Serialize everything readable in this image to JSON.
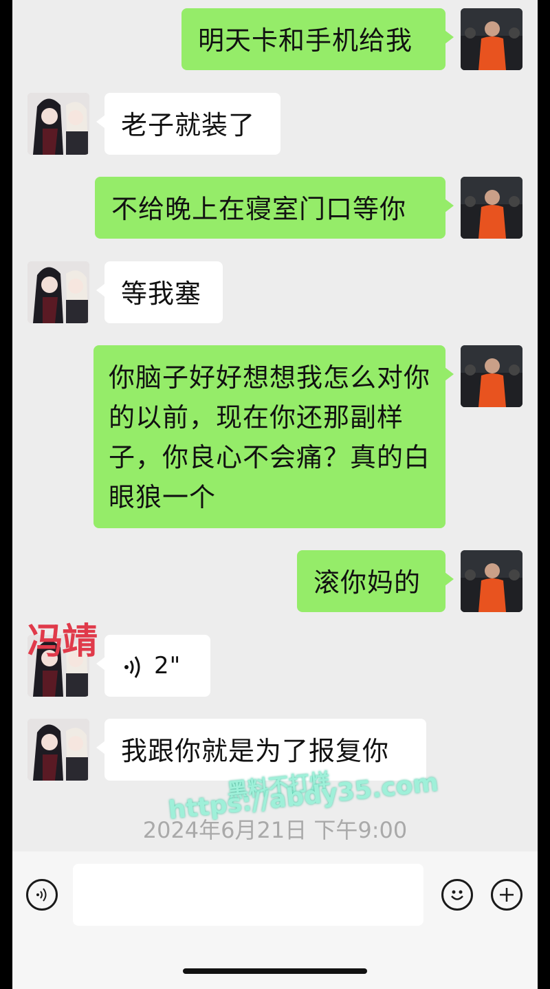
{
  "messages": [
    {
      "side": "me",
      "text": "明天卡和手机给我"
    },
    {
      "side": "other",
      "text": "老子就装了"
    },
    {
      "side": "me",
      "text": "不给晚上在寝室门口等你"
    },
    {
      "side": "other",
      "text": "等我塞"
    },
    {
      "side": "me",
      "text": "你脑子好好想想我怎么对你的以前，现在你还那副样子，你良心不会痛？真的白眼狼一个"
    },
    {
      "side": "me",
      "text": "滚你妈的"
    },
    {
      "side": "other",
      "type": "voice",
      "duration": "2\""
    },
    {
      "side": "other",
      "text": "我跟你就是为了报复你"
    }
  ],
  "overlay_name": "冯靖",
  "watermark": {
    "line1": "黑料不打烊",
    "line2": "https://abdy35.com"
  },
  "timestamp": "2024年6月21日 下午9:00",
  "input_bar": {
    "voice_icon": "voice-icon",
    "emoji_icon": "emoji-icon",
    "add_icon": "plus-icon"
  },
  "colors": {
    "my_bubble": "#95ec69",
    "other_bubble": "#ffffff",
    "background": "#ededed"
  }
}
